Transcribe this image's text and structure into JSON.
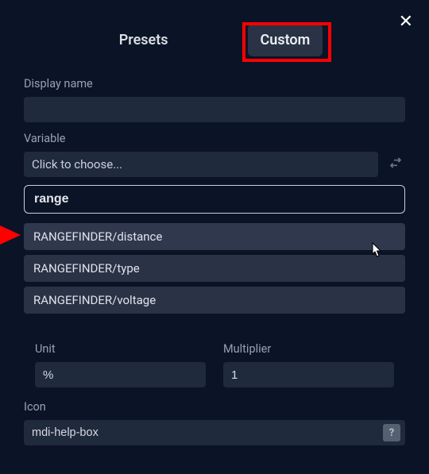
{
  "close_label": "✕",
  "tabs": {
    "presets": "Presets",
    "custom": "Custom"
  },
  "display_name": {
    "label": "Display name",
    "value": ""
  },
  "variable": {
    "label": "Variable",
    "select_placeholder": "Click to choose...",
    "search_value": "range",
    "options": [
      "RANGEFINDER/distance",
      "RANGEFINDER/type",
      "RANGEFINDER/voltage"
    ]
  },
  "unit": {
    "label": "Unit",
    "value": "%"
  },
  "multiplier": {
    "label": "Multiplier",
    "value": "1"
  },
  "icon_field": {
    "label": "Icon",
    "value": "mdi-help-box",
    "help": "?"
  }
}
